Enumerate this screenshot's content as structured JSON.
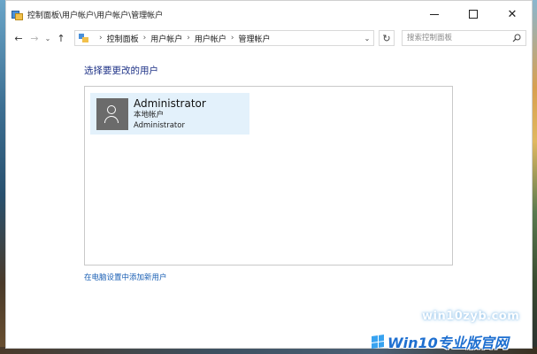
{
  "window": {
    "title": "控制面板\\用户帐户\\用户帐户\\管理帐户",
    "icon": "control-panel-icon"
  },
  "nav": {
    "back_icon": "arrow-left-icon",
    "forward_icon": "arrow-right-icon",
    "recent_icon": "chevron-down-icon",
    "up_icon": "arrow-up-icon",
    "breadcrumbs": [
      "控制面板",
      "用户帐户",
      "用户帐户",
      "管理帐户"
    ],
    "refresh_icon": "refresh-icon",
    "search_placeholder": "搜索控制面板"
  },
  "main": {
    "heading": "选择要更改的用户",
    "accounts": [
      {
        "name": "Administrator",
        "type": "本地帐户",
        "role": "Administrator",
        "icon": "user-avatar-icon"
      }
    ],
    "add_user_link": "在电脑设置中添加新用户"
  },
  "watermark": {
    "url": "win10zyb.com",
    "brand": "Win10专业版官网"
  },
  "colors": {
    "heading": "#1e3287",
    "link": "#1a5fb4",
    "tile_bg": "#e3f1fb",
    "avatar_bg": "#6b6b6b"
  }
}
